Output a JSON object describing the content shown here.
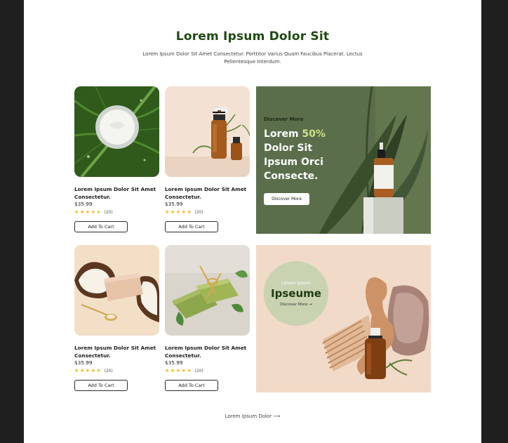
{
  "header": {
    "title": "Lorem Ipsum Dolor Sit",
    "subtitle": "Lorem Ipsum Dolor Sit Amet Consectetur. Porttitor Varius Quam Faucibus Placerat. Lectus Pellentesque Interdum."
  },
  "products": [
    {
      "name": "Lorem Ipsum Dolor Sit Amet Consectetur.",
      "price": "$35.99",
      "rating": 5,
      "reviews": "(20)",
      "cta": "Add To Cart",
      "image": "cream-jar-on-leaf"
    },
    {
      "name": "Lorem Ipsum Dolor Sit Amet Consectetur.",
      "price": "$35.99",
      "rating": 5,
      "reviews": "(20)",
      "cta": "Add To Cart",
      "image": "amber-serum-bottles"
    },
    {
      "name": "Lorem Ipsum Dolor Sit Amet Consectetur.",
      "price": "$35.99",
      "rating": 5,
      "reviews": "(20)",
      "cta": "Add To Cart",
      "image": "coconut-and-soap"
    },
    {
      "name": "Lorem Ipsum Dolor Sit Amet Consectetur.",
      "price": "$35.99",
      "rating": 5,
      "reviews": "(20)",
      "cta": "Add To Cart",
      "image": "herbal-soap-bars"
    }
  ],
  "promo_green": {
    "eyebrow": "Discover More",
    "headline_pre": "Lorem ",
    "headline_accent": "50%",
    "headline_post": "Dolor Sit Ipsum Orci Consecte.",
    "button": "Discover More",
    "accent_color": "#cfe08a",
    "background_color": "#5a6e4b"
  },
  "promo_beige": {
    "eyebrow": "Lorem Ipsum",
    "title": "Ipseume",
    "link": "Discover More →",
    "background_color": "#f1dac8"
  },
  "footer": {
    "link": "Lorem Ipsum Dolor ⟶"
  },
  "colors": {
    "title": "#1f4a12",
    "star": "#f2b51c"
  }
}
